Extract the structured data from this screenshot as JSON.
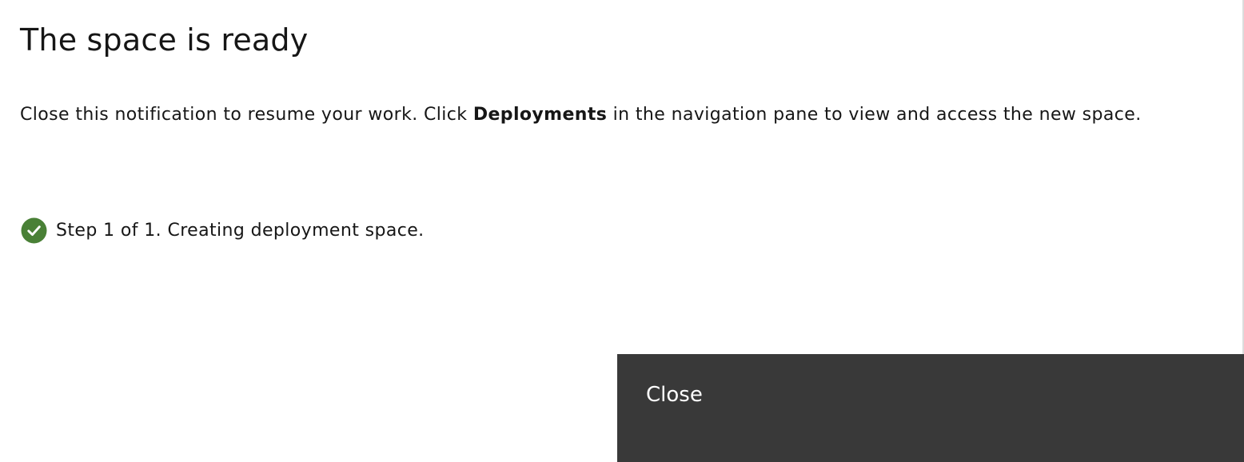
{
  "dialog": {
    "title": "The space is ready",
    "message": {
      "before": "Close this notification to resume your work. Click ",
      "emphasis": "Deployments",
      "after": " in the navigation pane to view and access the new space."
    },
    "step": {
      "icon": "checkmark-filled-icon",
      "status": "complete",
      "status_color": "#42be65",
      "text": "Step 1 of 1. Creating deployment space."
    },
    "close_button": {
      "label": "Close",
      "background": "#393939"
    }
  }
}
